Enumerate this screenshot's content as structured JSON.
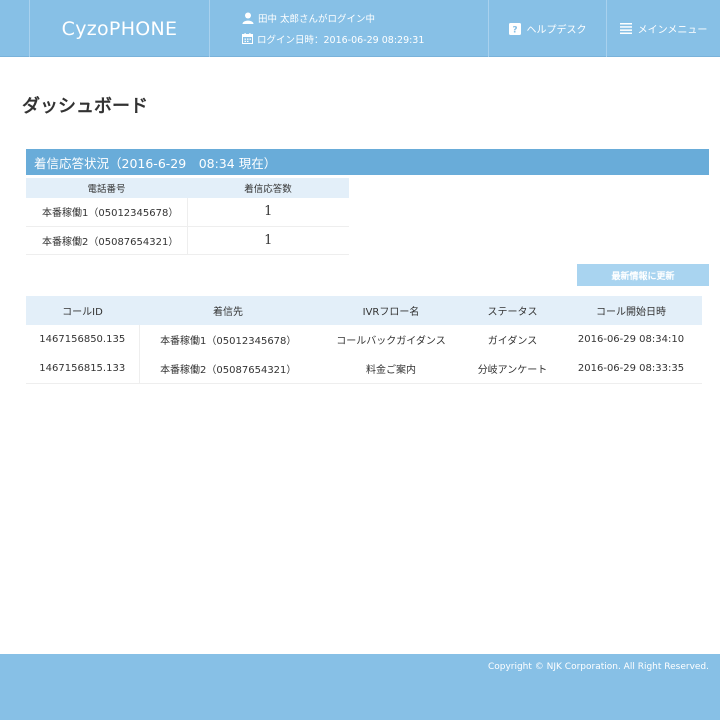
{
  "header": {
    "logo": "CyzoPHONE",
    "user_text": "田中 太郎さんがログイン中",
    "login_text": "ログイン日時：2016-06-29 08:29:31",
    "help_label": "ヘルプデスク",
    "menu_label": "メインメニュー"
  },
  "page": {
    "title": "ダッシュボード"
  },
  "status": {
    "heading": "着信応答状況（2016-6-29　08:34 現在）",
    "columns": [
      "電話番号",
      "着信応答数"
    ],
    "rows": [
      {
        "phone": "本番稼働1（05012345678）",
        "count": "1"
      },
      {
        "phone": "本番稼働2（05087654321）",
        "count": "1"
      }
    ]
  },
  "refresh_label": "最新情報に更新",
  "calls": {
    "columns": [
      "コールID",
      "着信先",
      "IVRフロー名",
      "ステータス",
      "コール開始日時"
    ],
    "rows": [
      {
        "id": "1467156850.135",
        "dest": "本番稼働1（05012345678）",
        "flow": "コールバックガイダンス",
        "status": "ガイダンス",
        "start": "2016-06-29 08:34:10"
      },
      {
        "id": "1467156815.133",
        "dest": "本番稼働2（05087654321）",
        "flow": "料金ご案内",
        "status": "分岐アンケート",
        "start": "2016-06-29 08:33:35"
      }
    ]
  },
  "footer": {
    "copyright": "Copyright © NJK Corporation. All Right Reserved."
  },
  "colors": {
    "header_bg": "#87c0e6",
    "panel_header": "#69acd9",
    "table_header": "#e3eff9",
    "button": "#a9d4f0"
  }
}
